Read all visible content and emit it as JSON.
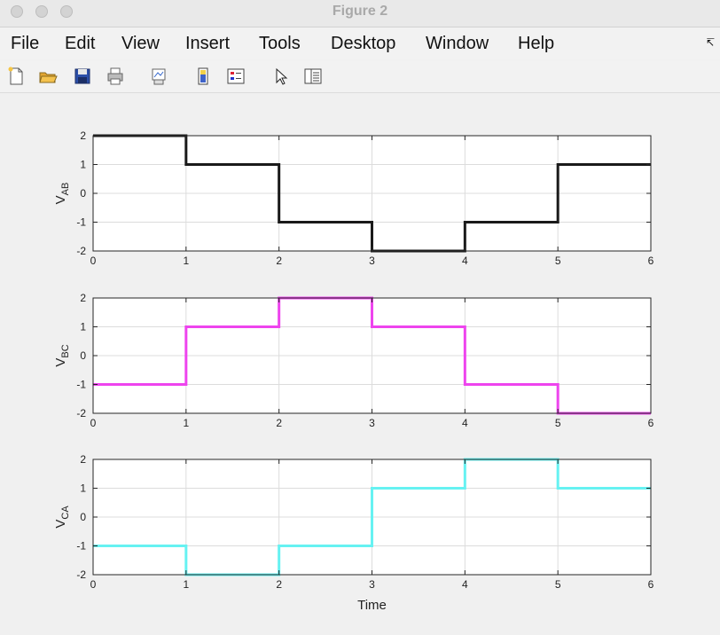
{
  "window": {
    "title": "Figure 2"
  },
  "menu": [
    "File",
    "Edit",
    "View",
    "Insert",
    "Tools",
    "Desktop",
    "Window",
    "Help"
  ],
  "toolbar": [
    "new-figure-icon",
    "open-icon",
    "save-icon",
    "print-icon",
    "link-plot-icon",
    "insert-colorbar-icon",
    "insert-legend-icon",
    "edit-plot-pointer-icon",
    "property-inspector-icon"
  ],
  "chart_data": [
    {
      "type": "line",
      "step": "post",
      "ylabel": "VAB",
      "ylabel_main": "V",
      "ylabel_sub": "AB",
      "xlabel": "",
      "color": "#1a1a1a",
      "x": [
        0,
        1,
        2,
        3,
        4,
        5,
        6
      ],
      "values": [
        2,
        1,
        -1,
        -2,
        -1,
        1,
        1
      ],
      "xlim": [
        0,
        6
      ],
      "ylim": [
        -2,
        2
      ],
      "xticks": [
        "0",
        "1",
        "2",
        "3",
        "4",
        "5",
        "6"
      ],
      "yticks": [
        "-2",
        "-1",
        "0",
        "1",
        "2"
      ],
      "grid": true
    },
    {
      "type": "line",
      "step": "post",
      "ylabel": "VBC",
      "ylabel_main": "V",
      "ylabel_sub": "BC",
      "xlabel": "",
      "color": "#ee44ee",
      "x": [
        0,
        1,
        2,
        3,
        4,
        5,
        6
      ],
      "values": [
        -1,
        1,
        2,
        1,
        -1,
        -2,
        -2
      ],
      "xlim": [
        0,
        6
      ],
      "ylim": [
        -2,
        2
      ],
      "xticks": [
        "0",
        "1",
        "2",
        "3",
        "4",
        "5",
        "6"
      ],
      "yticks": [
        "-2",
        "-1",
        "0",
        "1",
        "2"
      ],
      "grid": true
    },
    {
      "type": "line",
      "step": "post",
      "ylabel": "VCA",
      "ylabel_main": "V",
      "ylabel_sub": "CA",
      "xlabel": "Time",
      "color": "#66f2f2",
      "x": [
        0,
        1,
        2,
        3,
        4,
        5,
        6
      ],
      "values": [
        -1,
        -2,
        -1,
        1,
        2,
        1,
        1
      ],
      "xlim": [
        0,
        6
      ],
      "ylim": [
        -2,
        2
      ],
      "xticks": [
        "0",
        "1",
        "2",
        "3",
        "4",
        "5",
        "6"
      ],
      "yticks": [
        "-2",
        "-1",
        "0",
        "1",
        "2"
      ],
      "grid": true
    }
  ]
}
